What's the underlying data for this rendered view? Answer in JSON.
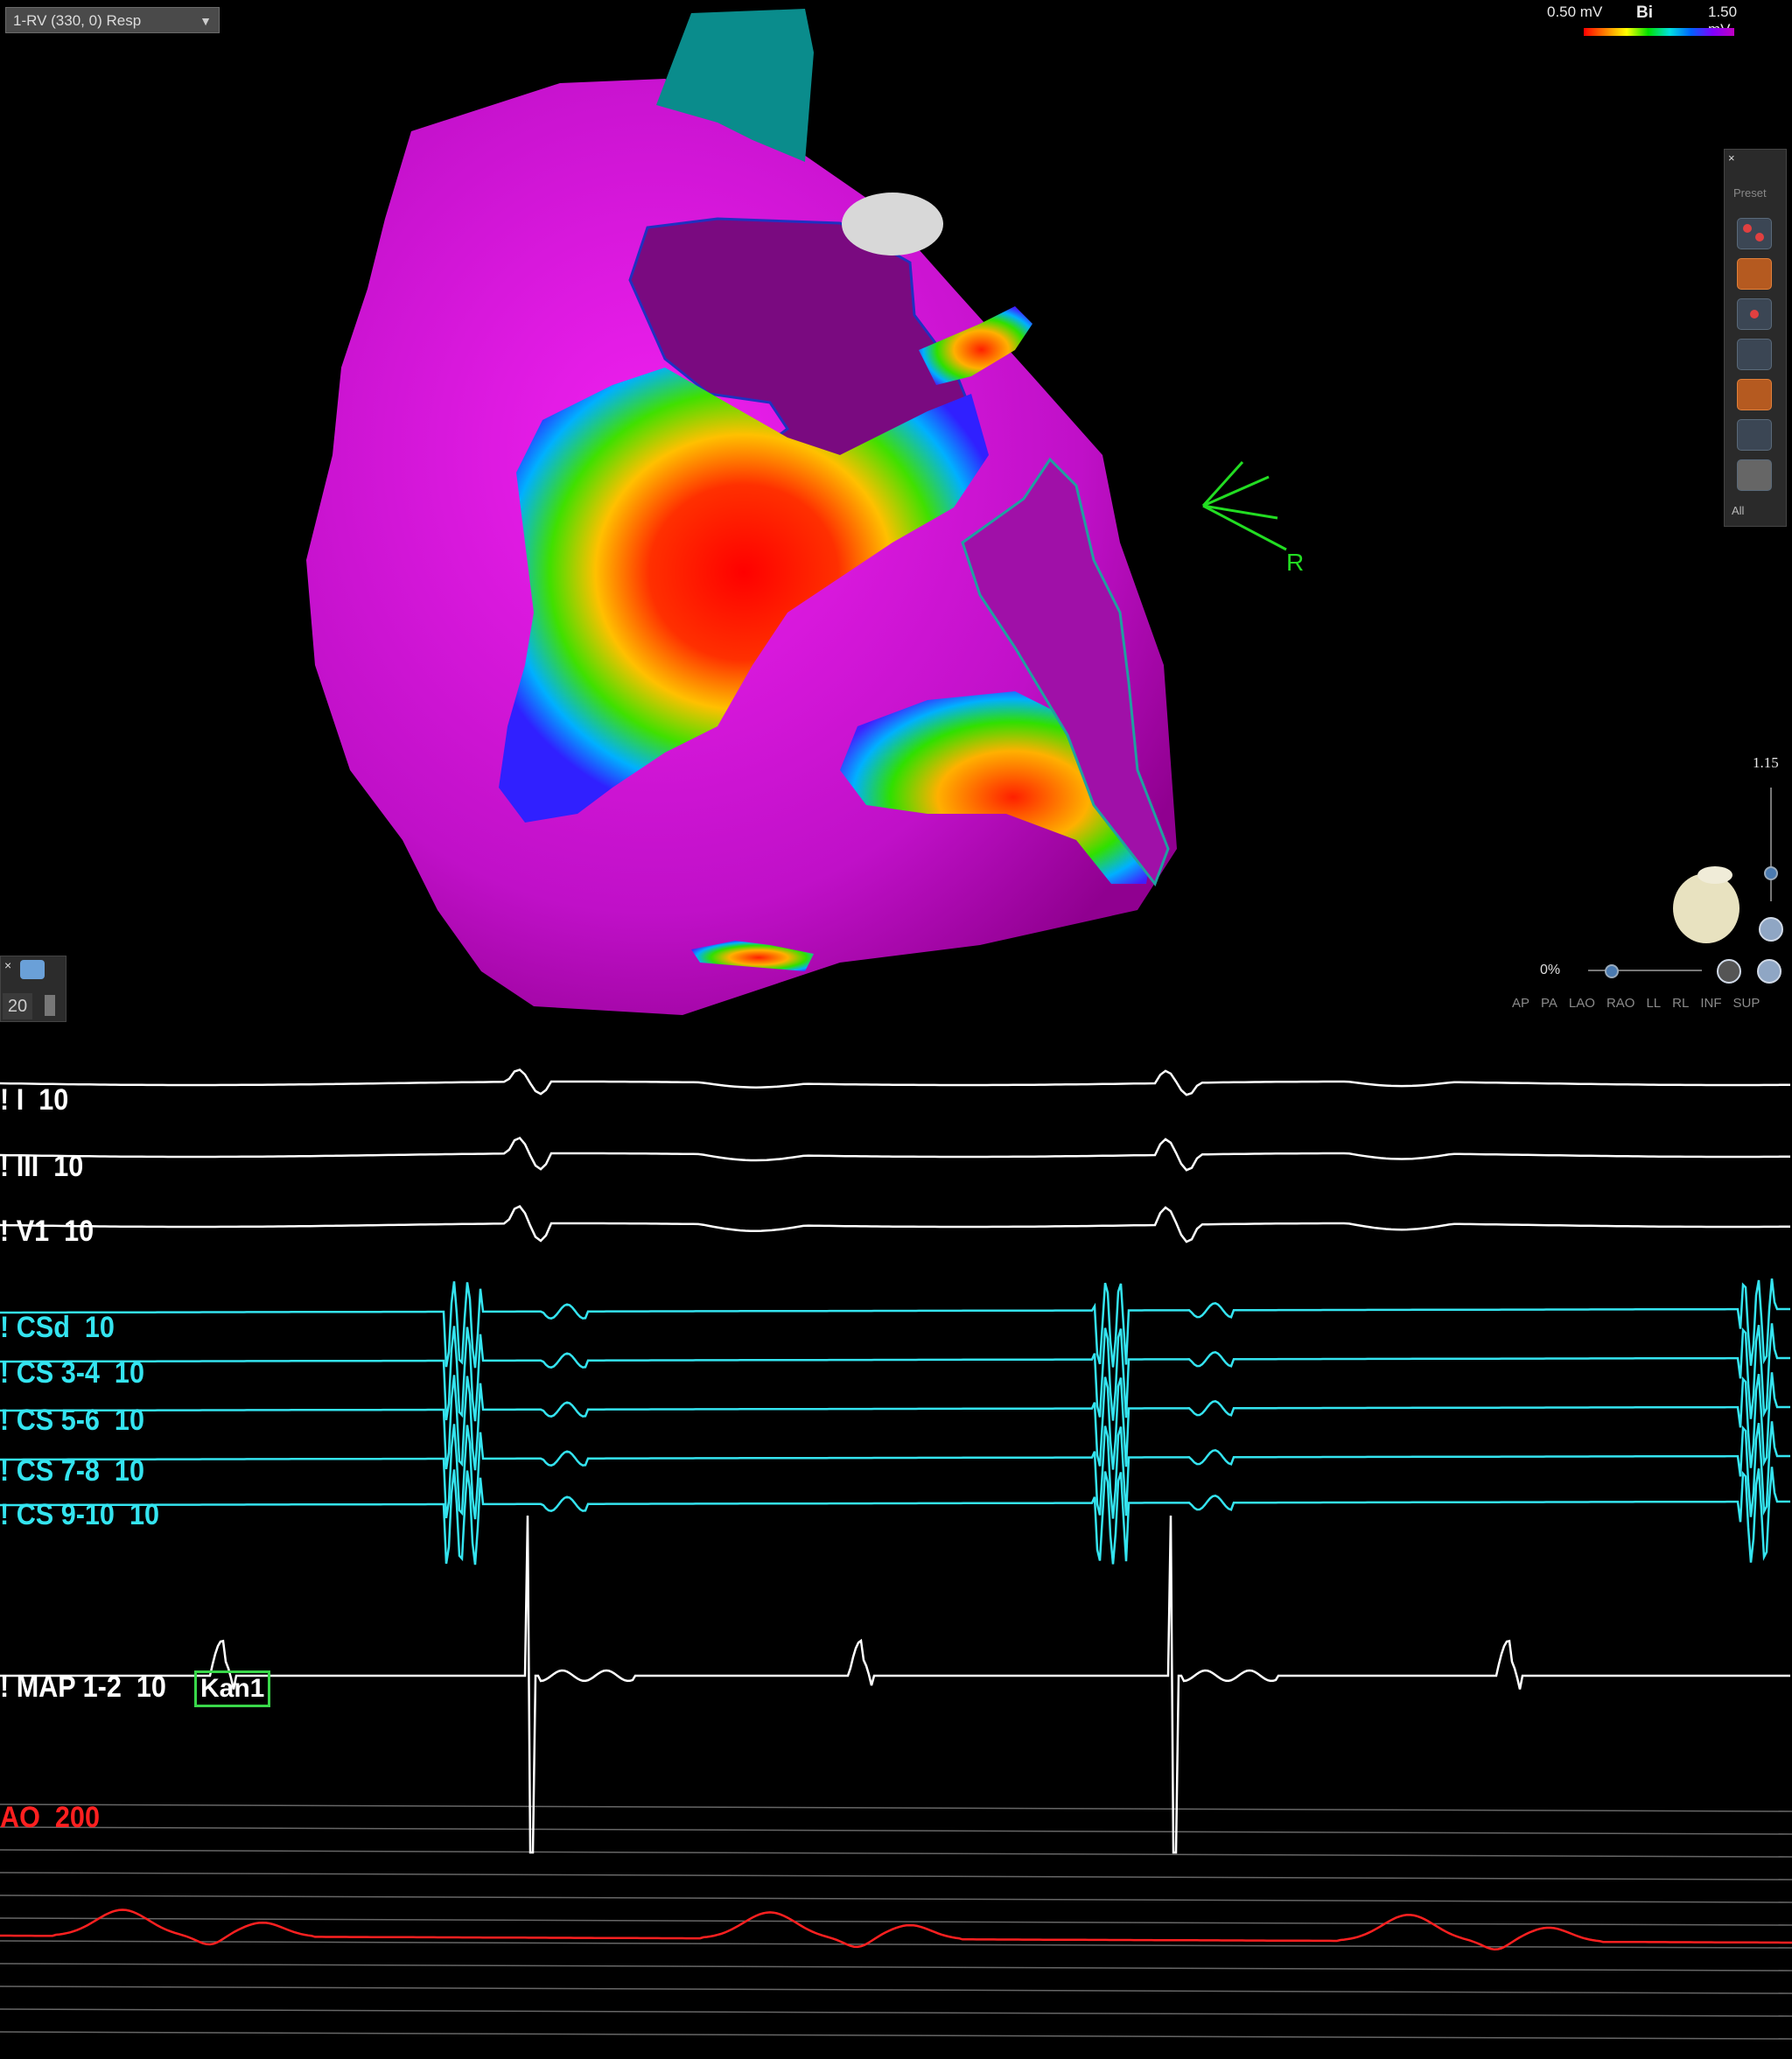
{
  "map": {
    "map_name": "1-RV (330, 0) Resp",
    "scale_min": "0.50 mV",
    "scale_mode": "Bi",
    "scale_max": "1.50 mV",
    "orientation_marker": "R",
    "zoom_value": "1.15",
    "transparency": "0%",
    "view_buttons": [
      "AP",
      "PA",
      "LAO",
      "RAO",
      "LL",
      "RL",
      "INF",
      "SUP"
    ],
    "left_panel_value": "20",
    "colors": {
      "healthy": "#d010d8",
      "scar": "#ff0000",
      "orientation": "#22dd22"
    }
  },
  "toolbar": {
    "close": "×",
    "preset_label": "Preset",
    "all_label": "All",
    "icons": [
      "catheter-icon",
      "color-map-icon",
      "point-icon",
      "grid-icon",
      "palette-icon",
      "mesh-icon",
      "ruler-icon"
    ]
  },
  "channels": [
    {
      "label": "! I  10",
      "color": "white"
    },
    {
      "label": "! III  10",
      "color": "white"
    },
    {
      "label": "! V1  10",
      "color": "white"
    },
    {
      "label": "! CSd  10",
      "color": "cyan"
    },
    {
      "label": "! CS 3-4  10",
      "color": "cyan"
    },
    {
      "label": "! CS 5-6  10",
      "color": "cyan"
    },
    {
      "label": "! CS 7-8  10",
      "color": "cyan"
    },
    {
      "label": "! CS 9-10  10",
      "color": "cyan"
    },
    {
      "label": "! MAP 1-2  10",
      "color": "white"
    },
    {
      "label": "AO  200",
      "color": "red"
    }
  ],
  "map_channel_tag": "Kan1"
}
